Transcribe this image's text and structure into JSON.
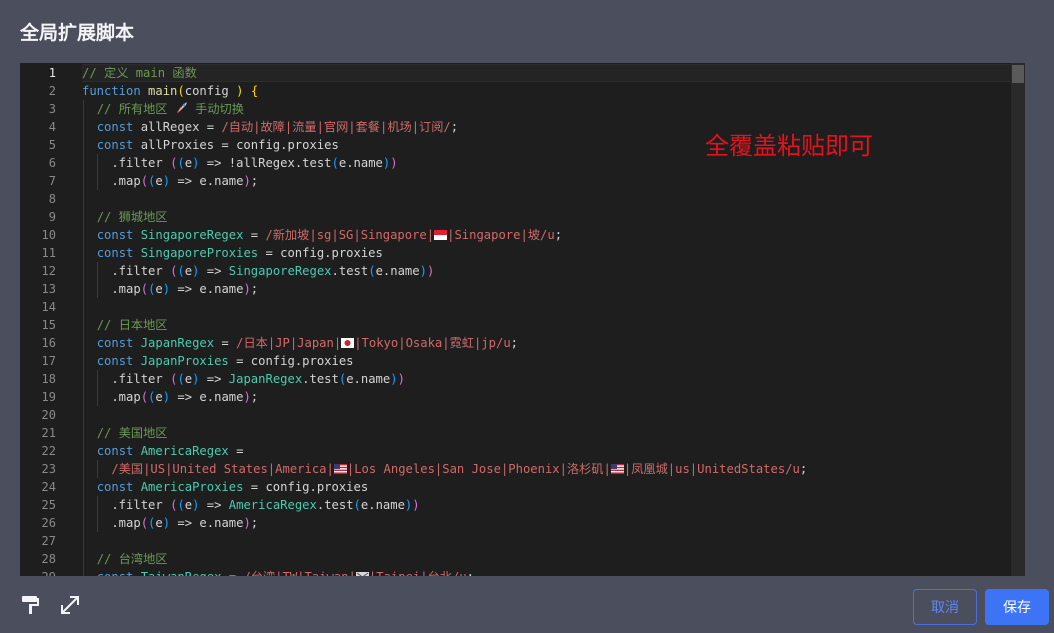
{
  "dialog": {
    "title": "全局扩展脚本"
  },
  "annotation": "全覆盖粘贴即可",
  "colors": {
    "save_button": "#3d73f5",
    "annotation": "#e5121d",
    "cancel_border": "#4a6fd8"
  },
  "editor": {
    "current_line": 1,
    "lines": [
      [
        [
          "cm",
          "// 定义 main 函数"
        ]
      ],
      [
        [
          "kw",
          "function"
        ],
        [
          "pl",
          " "
        ],
        [
          "fn",
          "main"
        ],
        [
          "br1",
          "("
        ],
        [
          "pl",
          "config "
        ],
        [
          "br1",
          ")"
        ],
        [
          "pl",
          " "
        ],
        [
          "br1",
          "{"
        ]
      ],
      [
        [
          "pl",
          "  "
        ],
        [
          "cm",
          "// 所有地区 "
        ],
        [
          "emoji",
          "rocket"
        ],
        [
          "cm",
          " 手动切换"
        ]
      ],
      [
        [
          "pl",
          "  "
        ],
        [
          "kw",
          "const"
        ],
        [
          "pl",
          " allRegex = "
        ],
        [
          "re",
          "/自动|故障|流量|官网|套餐|机场|订阅/"
        ],
        [
          "pl",
          ";"
        ]
      ],
      [
        [
          "pl",
          "  "
        ],
        [
          "kw",
          "const"
        ],
        [
          "pl",
          " allProxies = config.proxies"
        ]
      ],
      [
        [
          "pl",
          "    .filter "
        ],
        [
          "br2",
          "("
        ],
        [
          "br3",
          "("
        ],
        [
          "pl",
          "e"
        ],
        [
          "br3",
          ")"
        ],
        [
          "pl",
          " => !allRegex.test"
        ],
        [
          "br3",
          "("
        ],
        [
          "pl",
          "e.name"
        ],
        [
          "br3",
          ")"
        ],
        [
          "br2",
          ")"
        ]
      ],
      [
        [
          "pl",
          "    .map"
        ],
        [
          "br2",
          "("
        ],
        [
          "br3",
          "("
        ],
        [
          "pl",
          "e"
        ],
        [
          "br3",
          ")"
        ],
        [
          "pl",
          " => e.name"
        ],
        [
          "br2",
          ")"
        ],
        [
          "pl",
          ";"
        ]
      ],
      [],
      [
        [
          "pl",
          "  "
        ],
        [
          "cm",
          "// 狮城地区"
        ]
      ],
      [
        [
          "pl",
          "  "
        ],
        [
          "kw",
          "const"
        ],
        [
          "pl",
          " "
        ],
        [
          "ty",
          "SingaporeRegex"
        ],
        [
          "pl",
          " = "
        ],
        [
          "re",
          "/新加坡|sg|SG|Singapore|"
        ],
        [
          "emoji",
          "sg"
        ],
        [
          "re",
          "|Singapore|坡/u"
        ],
        [
          "pl",
          ";"
        ]
      ],
      [
        [
          "pl",
          "  "
        ],
        [
          "kw",
          "const"
        ],
        [
          "pl",
          " "
        ],
        [
          "ty",
          "SingaporeProxies"
        ],
        [
          "pl",
          " = config.proxies"
        ]
      ],
      [
        [
          "pl",
          "    .filter "
        ],
        [
          "br2",
          "("
        ],
        [
          "br3",
          "("
        ],
        [
          "pl",
          "e"
        ],
        [
          "br3",
          ")"
        ],
        [
          "pl",
          " => "
        ],
        [
          "ty",
          "SingaporeRegex"
        ],
        [
          "pl",
          ".test"
        ],
        [
          "br3",
          "("
        ],
        [
          "pl",
          "e.name"
        ],
        [
          "br3",
          ")"
        ],
        [
          "br2",
          ")"
        ]
      ],
      [
        [
          "pl",
          "    .map"
        ],
        [
          "br2",
          "("
        ],
        [
          "br3",
          "("
        ],
        [
          "pl",
          "e"
        ],
        [
          "br3",
          ")"
        ],
        [
          "pl",
          " => e.name"
        ],
        [
          "br2",
          ")"
        ],
        [
          "pl",
          ";"
        ]
      ],
      [],
      [
        [
          "pl",
          "  "
        ],
        [
          "cm",
          "// 日本地区"
        ]
      ],
      [
        [
          "pl",
          "  "
        ],
        [
          "kw",
          "const"
        ],
        [
          "pl",
          " "
        ],
        [
          "ty",
          "JapanRegex"
        ],
        [
          "pl",
          " = "
        ],
        [
          "re",
          "/日本|JP|Japan|"
        ],
        [
          "emoji",
          "jp"
        ],
        [
          "re",
          "|Tokyo|Osaka|霓虹|jp/u"
        ],
        [
          "pl",
          ";"
        ]
      ],
      [
        [
          "pl",
          "  "
        ],
        [
          "kw",
          "const"
        ],
        [
          "pl",
          " "
        ],
        [
          "ty",
          "JapanProxies"
        ],
        [
          "pl",
          " = config.proxies"
        ]
      ],
      [
        [
          "pl",
          "    .filter "
        ],
        [
          "br2",
          "("
        ],
        [
          "br3",
          "("
        ],
        [
          "pl",
          "e"
        ],
        [
          "br3",
          ")"
        ],
        [
          "pl",
          " => "
        ],
        [
          "ty",
          "JapanRegex"
        ],
        [
          "pl",
          ".test"
        ],
        [
          "br3",
          "("
        ],
        [
          "pl",
          "e.name"
        ],
        [
          "br3",
          ")"
        ],
        [
          "br2",
          ")"
        ]
      ],
      [
        [
          "pl",
          "    .map"
        ],
        [
          "br2",
          "("
        ],
        [
          "br3",
          "("
        ],
        [
          "pl",
          "e"
        ],
        [
          "br3",
          ")"
        ],
        [
          "pl",
          " => e.name"
        ],
        [
          "br2",
          ")"
        ],
        [
          "pl",
          ";"
        ]
      ],
      [],
      [
        [
          "pl",
          "  "
        ],
        [
          "cm",
          "// 美国地区"
        ]
      ],
      [
        [
          "pl",
          "  "
        ],
        [
          "kw",
          "const"
        ],
        [
          "pl",
          " "
        ],
        [
          "ty",
          "AmericaRegex"
        ],
        [
          "pl",
          " ="
        ]
      ],
      [
        [
          "pl",
          "    "
        ],
        [
          "re",
          "/美国|US|United States|America|"
        ],
        [
          "emoji",
          "us"
        ],
        [
          "re",
          "|Los Angeles|San Jose|Phoenix|洛杉矶|"
        ],
        [
          "emoji",
          "us"
        ],
        [
          "re",
          "|凤凰城|us|UnitedStates/u"
        ],
        [
          "pl",
          ";"
        ]
      ],
      [
        [
          "pl",
          "  "
        ],
        [
          "kw",
          "const"
        ],
        [
          "pl",
          " "
        ],
        [
          "ty",
          "AmericaProxies"
        ],
        [
          "pl",
          " = config.proxies"
        ]
      ],
      [
        [
          "pl",
          "    .filter "
        ],
        [
          "br2",
          "("
        ],
        [
          "br3",
          "("
        ],
        [
          "pl",
          "e"
        ],
        [
          "br3",
          ")"
        ],
        [
          "pl",
          " => "
        ],
        [
          "ty",
          "AmericaRegex"
        ],
        [
          "pl",
          ".test"
        ],
        [
          "br3",
          "("
        ],
        [
          "pl",
          "e.name"
        ],
        [
          "br3",
          ")"
        ],
        [
          "br2",
          ")"
        ]
      ],
      [
        [
          "pl",
          "    .map"
        ],
        [
          "br2",
          "("
        ],
        [
          "br3",
          "("
        ],
        [
          "pl",
          "e"
        ],
        [
          "br3",
          ")"
        ],
        [
          "pl",
          " => e.name"
        ],
        [
          "br2",
          ")"
        ],
        [
          "pl",
          ";"
        ]
      ],
      [],
      [
        [
          "pl",
          "  "
        ],
        [
          "cm",
          "// 台湾地区"
        ]
      ],
      [
        [
          "pl",
          "  "
        ],
        [
          "kw",
          "const"
        ],
        [
          "pl",
          " "
        ],
        [
          "ty",
          "TaiwanRegex"
        ],
        [
          "pl",
          " = "
        ],
        [
          "re",
          "/台湾|TW|Taiwan|"
        ],
        [
          "emoji",
          "tw"
        ],
        [
          "re",
          "|Taipei|台北/u"
        ],
        [
          "pl",
          ";"
        ]
      ]
    ]
  },
  "toolbar": {
    "format_icon": "paint-roller-icon",
    "fullscreen_icon": "expand-arrows-icon",
    "cancel_label": "取消",
    "save_label": "保存"
  }
}
